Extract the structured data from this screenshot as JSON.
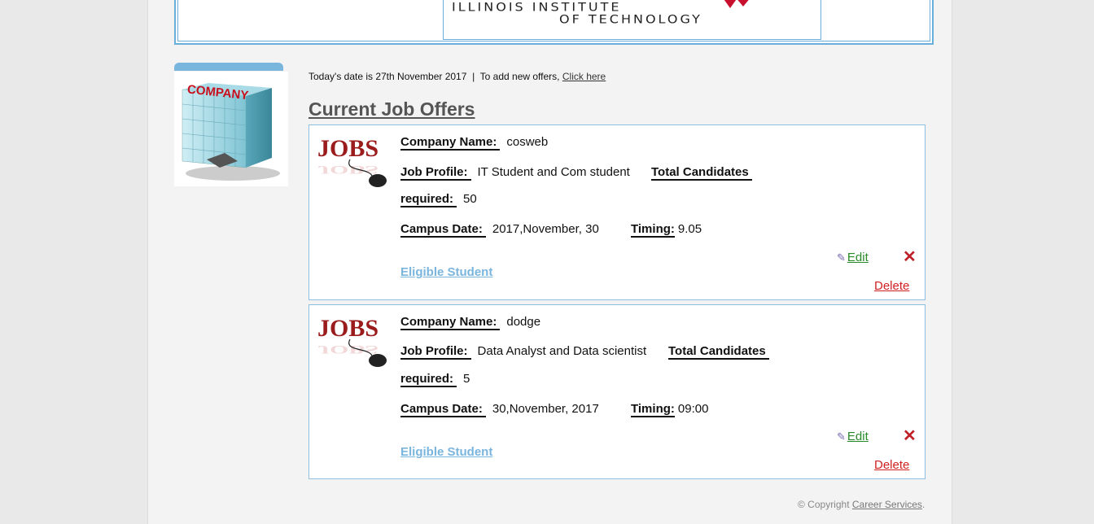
{
  "header": {
    "logo_line1": "ILLINOIS INSTITUTE",
    "logo_line2": "OF TECHNOLOGY"
  },
  "sidebar": {
    "image_text": "COMPANY"
  },
  "info": {
    "date_text": "Today's date is 27th November 2017",
    "separator": "|",
    "add_text": "To add new offers,",
    "add_link": "Click here"
  },
  "section_title": "Current Job Offers",
  "labels": {
    "company_name": "Company Name:",
    "job_profile": "Job Profile:",
    "total_candidates": "Total Candidates",
    "required": "required:",
    "campus_date": "Campus Date:",
    "timing": "Timing:",
    "eligible": "Eligible Student",
    "edit": "Edit",
    "delete": "Delete",
    "jobs_image_text": "JOBS"
  },
  "jobs": [
    {
      "company_name": "cosweb",
      "job_profile": "IT Student and Com student",
      "required": "50",
      "campus_date": "2017,November, 30",
      "timing": "9.05"
    },
    {
      "company_name": "dodge",
      "job_profile": "Data Analyst and Data scientist",
      "required": "5",
      "campus_date": "30,November, 2017",
      "timing": "09:00"
    }
  ],
  "footer": {
    "copyright_text": "© Copyright",
    "copyright_link": "Career Services",
    "period": "."
  },
  "colors": {
    "accent_blue": "#7ab5de",
    "delete_red": "#d02020",
    "edit_green": "#2a8a2a"
  }
}
